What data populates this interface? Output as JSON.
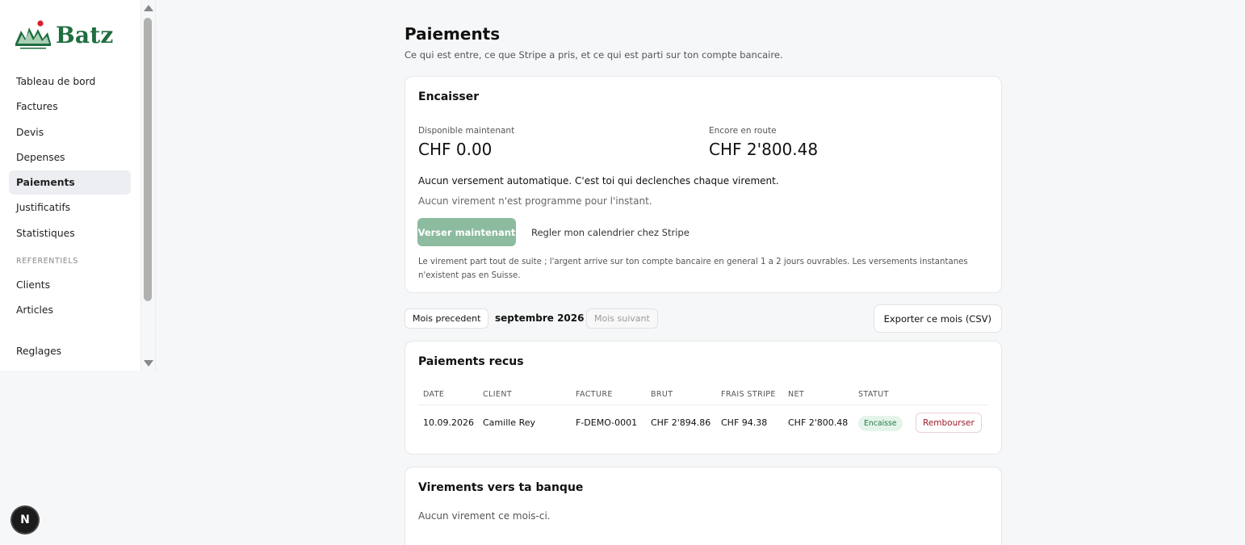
{
  "brand": {
    "name": "Batz",
    "color": "#1f6e3f",
    "accent": "#d71f2b"
  },
  "sidebar": {
    "items": [
      {
        "label": "Tableau de bord"
      },
      {
        "label": "Factures"
      },
      {
        "label": "Devis"
      },
      {
        "label": "Depenses"
      },
      {
        "label": "Paiements",
        "active": true
      },
      {
        "label": "Justificatifs"
      },
      {
        "label": "Statistiques"
      }
    ],
    "section_label": "REFERENTIELS",
    "section_items": [
      {
        "label": "Clients"
      },
      {
        "label": "Articles"
      }
    ],
    "bottom_item": {
      "label": "Reglages"
    }
  },
  "floating_badge": "N",
  "page": {
    "title": "Paiements",
    "subtitle": "Ce qui est entre, ce que Stripe a pris, et ce qui est parti sur ton compte bancaire."
  },
  "encaisser": {
    "title": "Encaisser",
    "available_label": "Disponible maintenant",
    "available_value": "CHF 0.00",
    "pending_label": "Encore en route",
    "pending_value": "CHF 2'800.48",
    "info": "Aucun versement automatique. C'est toi qui declenches chaque virement.",
    "info_sub": "Aucun virement n'est programme pour l'instant.",
    "primary_button": "Verser maintenant",
    "link_button": "Regler mon calendrier chez Stripe",
    "note": "Le virement part tout de suite ; l'argent arrive sur ton compte bancaire en general 1 a 2 jours ouvrables. Les versements instantanes n'existent pas en Suisse.",
    "primary_color": "#8cbb9f"
  },
  "month_nav": {
    "prev": "Mois precedent",
    "current": "septembre 2026",
    "next": "Mois suivant",
    "export": "Exporter ce mois (CSV)"
  },
  "payments": {
    "title": "Paiements recus",
    "columns": [
      "DATE",
      "CLIENT",
      "FACTURE",
      "BRUT",
      "FRAIS STRIPE",
      "NET",
      "STATUT"
    ],
    "rows": [
      {
        "date": "10.09.2026",
        "client": "Camille Rey",
        "facture": "F-DEMO-0001",
        "brut": "CHF 2'894.86",
        "frais": "CHF 94.38",
        "net": "CHF 2'800.48",
        "statut": "Encaisse",
        "action": "Rembourser"
      }
    ],
    "status_color": "#1f7a45",
    "refund_color": "#9b1b2c"
  },
  "transfers": {
    "title": "Virements vers ta banque",
    "empty": "Aucun virement ce mois-ci."
  }
}
